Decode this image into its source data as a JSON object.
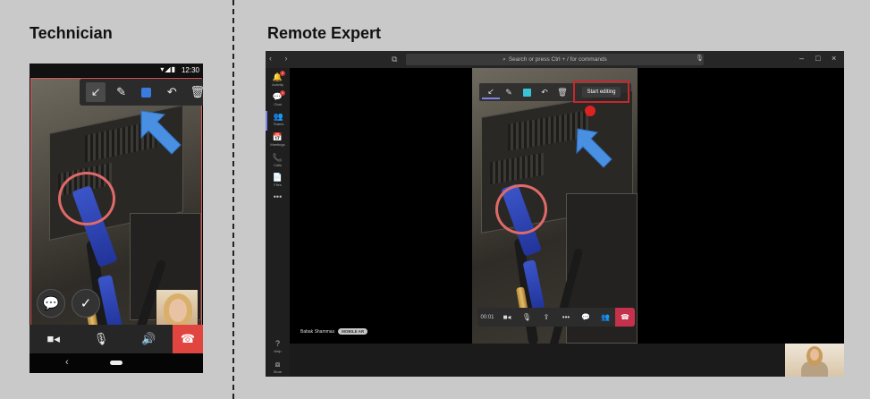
{
  "headings": {
    "left": "Technician",
    "right": "Remote Expert"
  },
  "phone": {
    "status": {
      "time": "12:30",
      "icons": "▾◢▮"
    },
    "toolbar": [
      {
        "icon": "↙",
        "name": "shrink-icon"
      },
      {
        "icon": "✎",
        "name": "pen-icon"
      },
      {
        "icon": "",
        "name": "color-swatch-icon"
      },
      {
        "icon": "↶",
        "name": "undo-icon"
      },
      {
        "icon": "🗑",
        "name": "trash-icon"
      }
    ],
    "chat_icon": "💬",
    "done_icon": "✓",
    "callbar": {
      "video": "■◂",
      "mic": "🎙",
      "speaker": "🔊",
      "hangup": "☎"
    },
    "nav": {
      "back": "‹"
    }
  },
  "teams": {
    "titlebar": {
      "nav": "‹ ›",
      "compose": "⧉",
      "search_placeholder": "Search or press Ctrl + / for commands",
      "mic": "🎙",
      "minimize": "–",
      "maximize": "□",
      "close": "×"
    },
    "rail": [
      {
        "icon": "🔔",
        "label": "Activity",
        "badge": "2"
      },
      {
        "icon": "💬",
        "label": "Chat",
        "badge": "1"
      },
      {
        "icon": "👥",
        "label": "Teams",
        "badge": ""
      },
      {
        "icon": "📅",
        "label": "Meetings",
        "badge": ""
      },
      {
        "icon": "📞",
        "label": "Calls",
        "badge": ""
      },
      {
        "icon": "📄",
        "label": "Files",
        "badge": ""
      },
      {
        "icon": "•••",
        "label": "",
        "badge": ""
      },
      {
        "icon": "?",
        "label": "Help",
        "badge": ""
      },
      {
        "icon": "⧈",
        "label": "Store",
        "badge": ""
      }
    ],
    "toolbar": [
      {
        "icon": "↙",
        "name": "shrink-icon"
      },
      {
        "icon": "✎",
        "name": "pen-icon"
      },
      {
        "icon": "",
        "name": "color-swatch-icon"
      },
      {
        "icon": "↶",
        "name": "undo-icon"
      },
      {
        "icon": "🗑",
        "name": "trash-icon"
      }
    ],
    "start_editing": "Start editing",
    "call": {
      "timer": "00:01",
      "video": "■◂",
      "mic": "🎙",
      "share": "⇪",
      "more": "•••",
      "chat": "💬",
      "participants": "👥",
      "hangup": "☎"
    },
    "participant": {
      "name": "Babak Shammas",
      "device": "MOBILE AR"
    },
    "colors": {
      "accent": "#7b83eb",
      "hangup": "#c4314b",
      "annotation": "#e06a6a",
      "highlight_box": "#c4282d"
    }
  }
}
